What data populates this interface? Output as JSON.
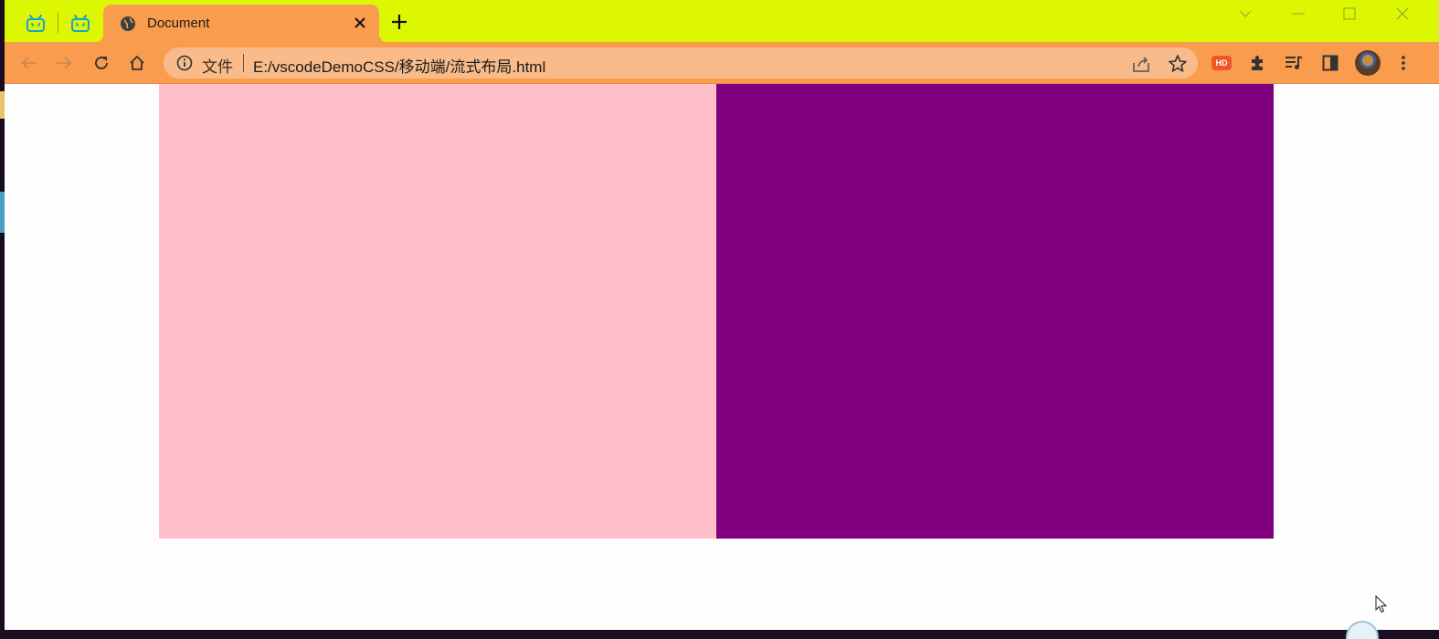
{
  "tabs": {
    "pinned": [
      {
        "icon": "bilibili-icon",
        "color": "#1aa5c8"
      },
      {
        "icon": "bilibili-icon",
        "color": "#1aa5c8"
      }
    ],
    "active": {
      "title": "Document",
      "icon": "globe-icon"
    },
    "new_tab_icon": "plus-icon"
  },
  "window_controls": [
    "chevron-down-icon",
    "minimize-icon",
    "maximize-icon",
    "close-icon"
  ],
  "toolbar": {
    "back_icon": "arrow-left-icon",
    "forward_icon": "arrow-right-icon",
    "reload_icon": "reload-icon",
    "home_icon": "home-icon",
    "address": {
      "chip_label": "文件",
      "url": "E:/vscodeDemoCSS/移动端/流式布局.html"
    },
    "extension_badge": "HD",
    "extensions": [
      "puzzle-icon",
      "media-queue-icon",
      "side-panel-icon",
      "avatar",
      "kebab-menu-icon"
    ]
  },
  "colors": {
    "tabbar_bg": "#ddf702",
    "toolbar_bg": "#f99c4d",
    "omnibox_bg": "#f9bb89",
    "left_box": "#ffc0cb",
    "right_box": "#800080",
    "page_bg": "#fefefe"
  },
  "page": {
    "boxes": [
      {
        "name": "pink-box",
        "color": "pink"
      },
      {
        "name": "purple-box",
        "color": "purple"
      }
    ]
  }
}
